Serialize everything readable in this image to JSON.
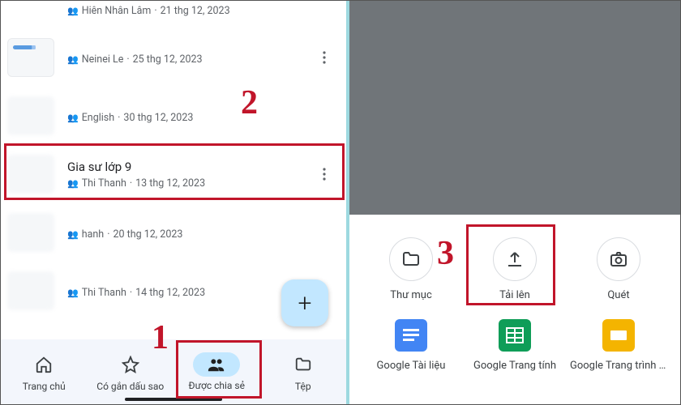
{
  "markers": {
    "one": "1",
    "two": "2",
    "three": "3"
  },
  "files": [
    {
      "name": "",
      "owner": "Hiên Nhân Lâm",
      "date": "21 thg 12, 2023"
    },
    {
      "name": "",
      "owner": "Neinei Le",
      "date": "25 thg 12, 2023"
    },
    {
      "name": "",
      "owner": "English",
      "date": "30 thg 12, 2023"
    },
    {
      "name": "Gia sư lớp 9",
      "owner": "Thi Thanh",
      "date": "13 thg 12, 2023"
    },
    {
      "name": "",
      "owner": "hanh",
      "date": "20 thg 12, 2023"
    },
    {
      "name": "",
      "owner": "Thi Thanh",
      "date": "14 thg 12, 2023"
    }
  ],
  "fab": {
    "label": "+"
  },
  "nav": {
    "home": "Trang chủ",
    "starred": "Có gắn dấu sao",
    "shared": "Được chia sẻ",
    "files": "Tệp"
  },
  "sheet": {
    "row1": [
      {
        "id": "folder",
        "label": "Thư mục"
      },
      {
        "id": "upload",
        "label": "Tải lên"
      },
      {
        "id": "scan",
        "label": "Quét"
      }
    ],
    "row2": [
      {
        "id": "docs",
        "label": "Google Tài liệu",
        "color": "#4285f4"
      },
      {
        "id": "sheets",
        "label": "Google Trang tính",
        "color": "#0f9d58"
      },
      {
        "id": "slides",
        "label": "Google Trang trình bày",
        "color": "#f4b400"
      }
    ]
  }
}
